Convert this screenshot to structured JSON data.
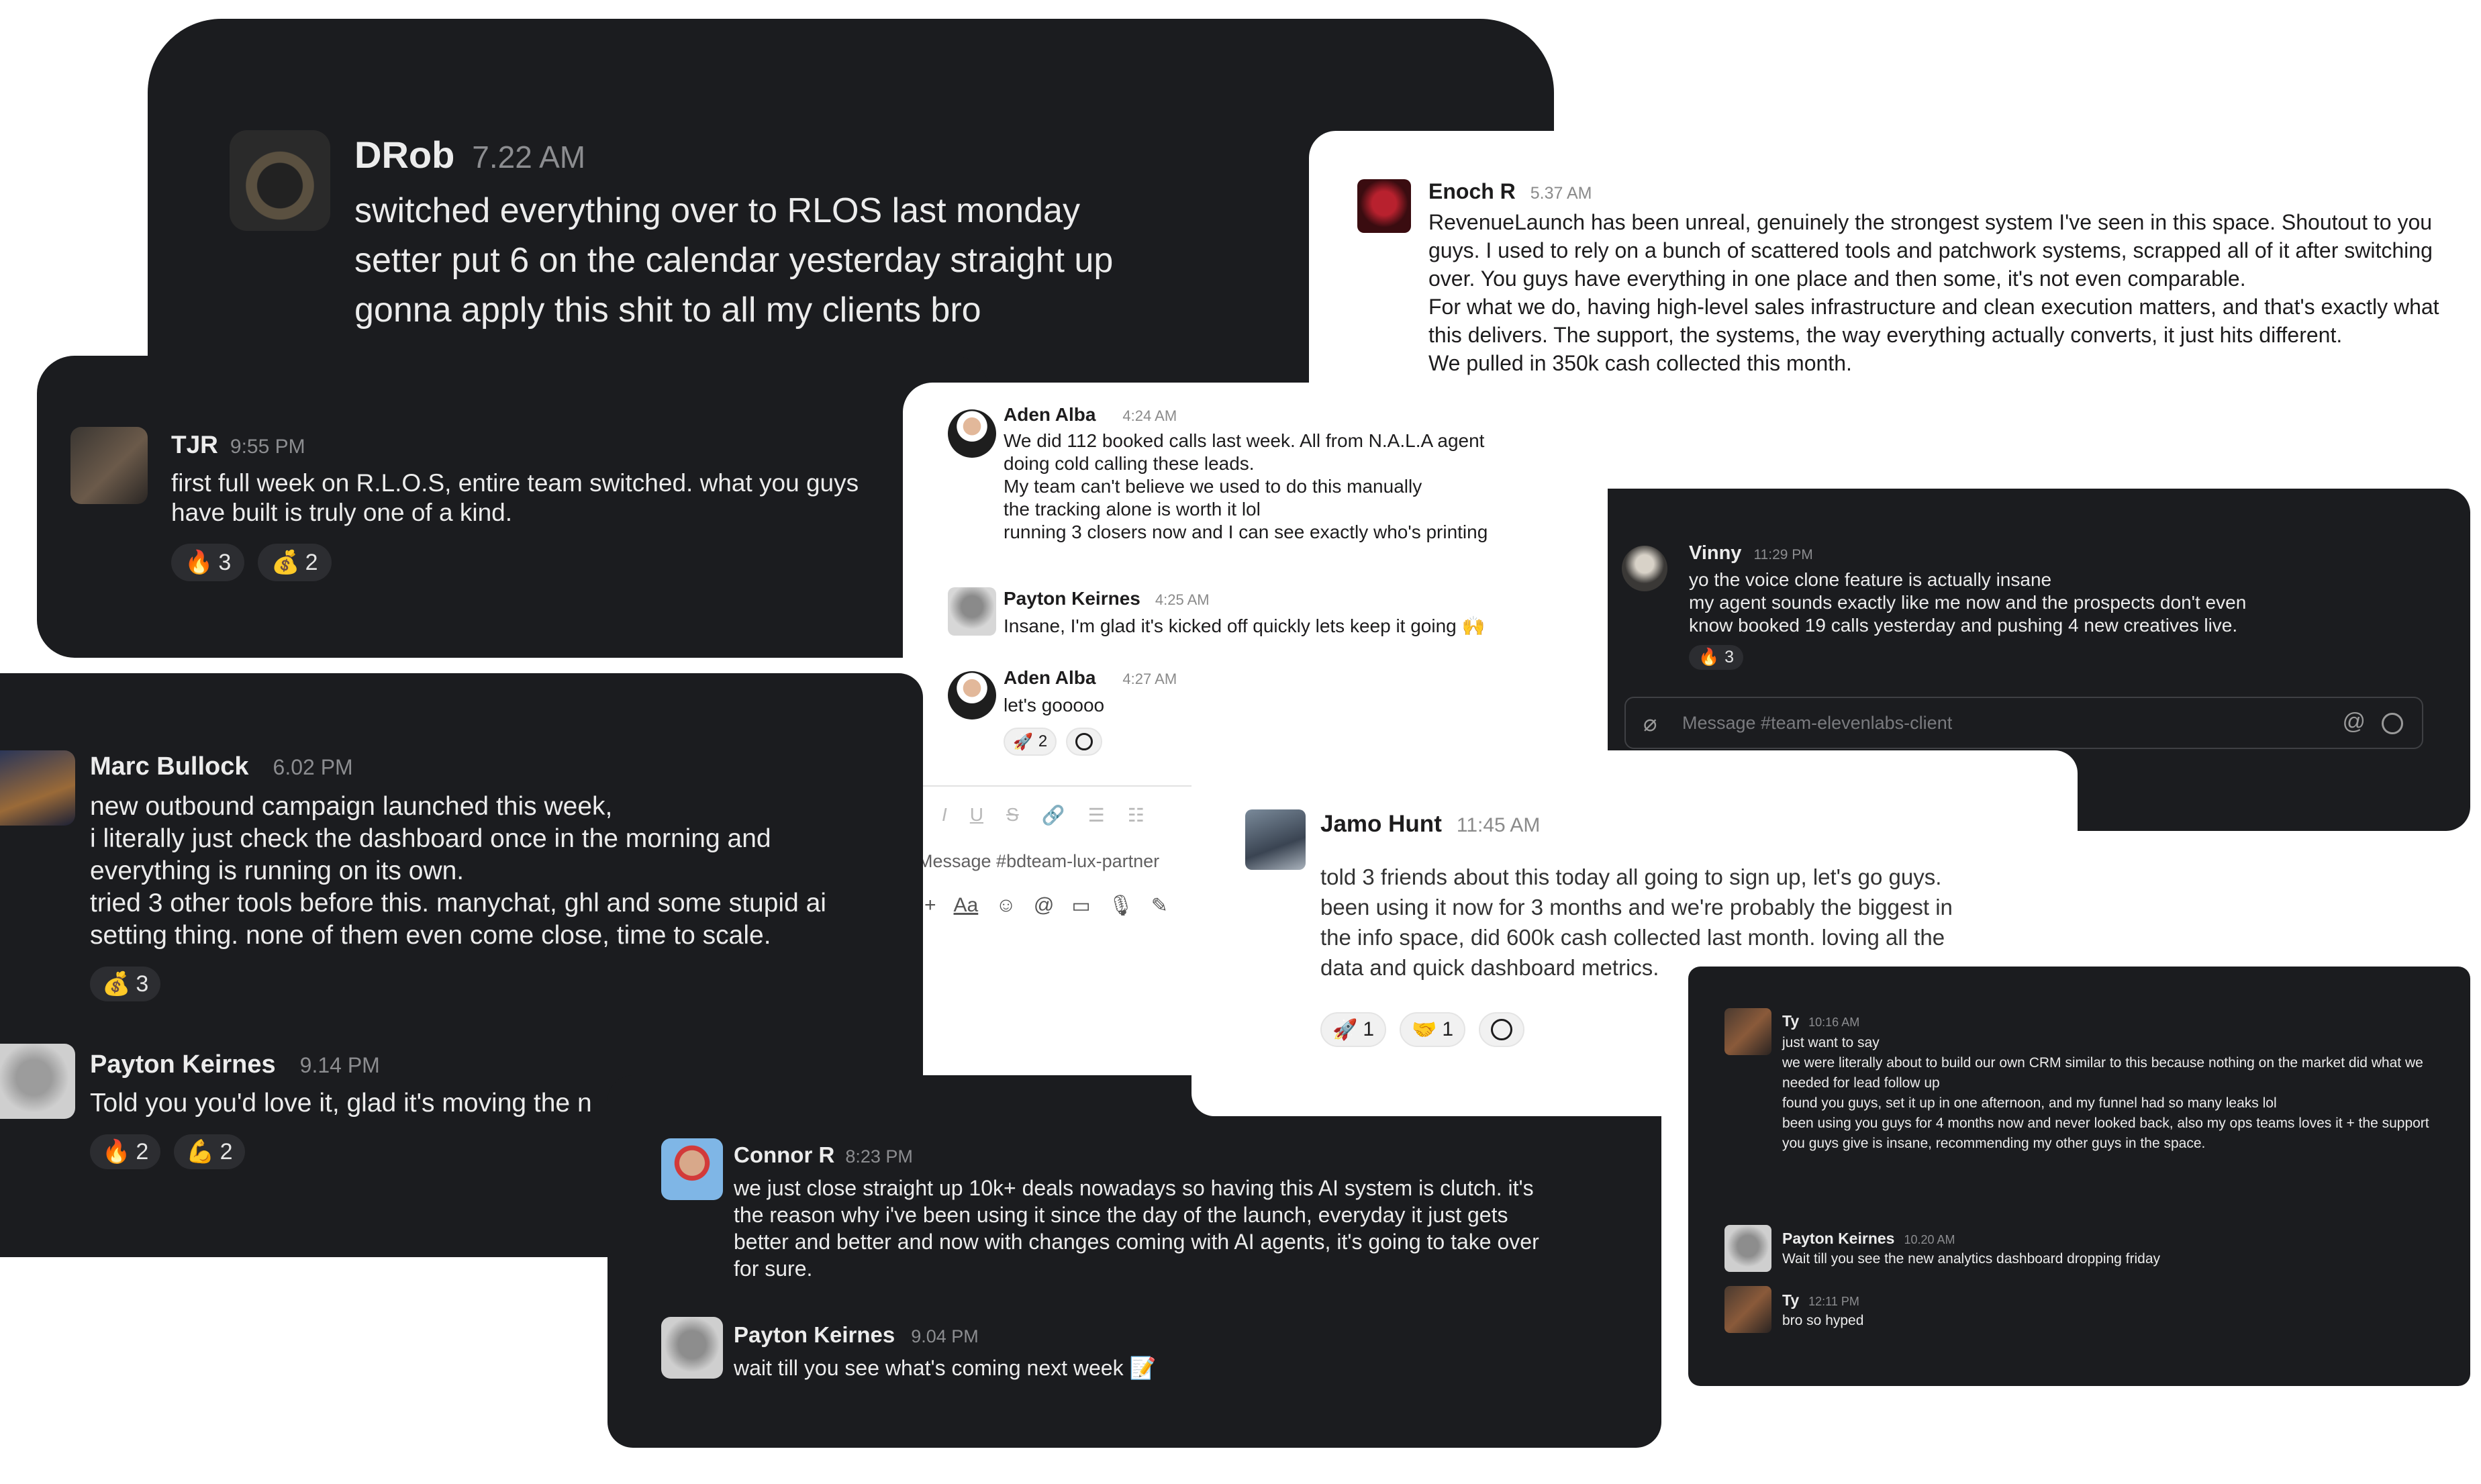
{
  "cards": {
    "drob": {
      "name": "DRob",
      "time": "7.22 AM",
      "text": "switched everything over to RLOS last monday\nsetter put 6 on the calendar yesterday straight up\ngonna apply this shit to all my clients bro"
    },
    "enoch": {
      "name": "Enoch R",
      "time": "5.37 AM",
      "text": "RevenueLaunch has been unreal, genuinely the strongest system I've seen in this space. Shoutout to you guys. I used to rely on a bunch of scattered tools and patchwork systems, scrapped all of it after switching over. You guys have everything in one place and then some, it's not even comparable.\nFor what we do, having high-level sales infrastructure and clean execution matters, and that's exactly what this delivers. The support, the systems, the way everything actually converts, it just hits different.\nWe pulled in 350k cash collected this month."
    },
    "tjr": {
      "name": "TJR",
      "time": "9:55 PM",
      "text": "first full week on R.L.O.S, entire team switched. what you guys have built is truly one of a kind.",
      "reactions": [
        {
          "emoji": "🔥",
          "count": "3"
        },
        {
          "emoji": "💰",
          "count": "2"
        }
      ]
    },
    "aden": {
      "messages": [
        {
          "name": "Aden Alba",
          "time": "4:24 AM",
          "text": "We did 112 booked calls last week. All from N.A.L.A agent\ndoing cold calling these leads.\nMy team can't believe we used to do this manually\nthe tracking alone is worth it lol\nrunning 3 closers now and I can see exactly who's printing"
        },
        {
          "name": "Payton Keirnes",
          "time": "4:25 AM",
          "text": "Insane, I'm glad it's kicked off quickly lets keep it going 🙌"
        },
        {
          "name": "Aden Alba",
          "time": "4:27 AM",
          "text": "let's gooooo"
        }
      ],
      "reaction": {
        "emoji": "🚀",
        "count": "2"
      },
      "toolbar": [
        "I",
        "U",
        "S",
        "🔗",
        "☰",
        "☷"
      ],
      "composer_placeholder": "Message #bdteam-lux-partner",
      "composer_tools": [
        "+",
        "Aa",
        "☺",
        "@",
        "▭",
        "🎙",
        "✎"
      ]
    },
    "vinny": {
      "name": "Vinny",
      "time": "11:29 PM",
      "text": "yo the voice clone feature is actually insane\nmy agent sounds exactly like me now and the prospects don't even\nknow booked 19 calls yesterday and pushing 4 new creatives live.",
      "reaction": {
        "emoji": "🔥",
        "count": "3"
      },
      "composer_placeholder": "Message #team-elevenlabs-client"
    },
    "marc": {
      "messages": [
        {
          "name": "Marc Bullock",
          "time": "6.02 PM",
          "text": "new outbound campaign launched this week,\ni literally just check the dashboard once in the morning and\neverything is running on its own.\ntried 3 other tools before this. manychat, ghl and some stupid ai\nsetting thing. none of them even come close, time to scale."
        },
        {
          "name": "Payton Keirnes",
          "time": "9.14 PM",
          "text": "Told you you'd love it, glad it's moving the n"
        }
      ],
      "reactions_1": [
        {
          "emoji": "💰",
          "count": "3"
        }
      ],
      "reactions_2": [
        {
          "emoji": "🔥",
          "count": "2"
        },
        {
          "emoji": "💪",
          "count": "2"
        }
      ]
    },
    "jamo": {
      "name": "Jamo Hunt",
      "time": "11:45 AM",
      "text": "told 3 friends about this today all going to sign up, let's go guys.\nbeen using it now for 3 months and we're probably the biggest in\nthe info space, did 600k cash collected last month. loving all the\ndata and quick dashboard metrics.",
      "reactions": [
        {
          "emoji": "🚀",
          "count": "1"
        },
        {
          "emoji": "🤝",
          "count": "1"
        }
      ]
    },
    "connor": {
      "messages": [
        {
          "name": "Connor R",
          "time": "8:23 PM",
          "text": "we just close straight up 10k+ deals nowadays so having this AI system is clutch. it's the reason why i've been using it since the day of the launch, everyday it just gets better and better and now with changes coming with AI agents, it's going to take over for sure."
        },
        {
          "name": "Payton Keirnes",
          "time": "9.04 PM",
          "text": "wait till you see what's coming next week 📝"
        }
      ]
    },
    "ty": {
      "messages": [
        {
          "name": "Ty",
          "time": "10:16 AM",
          "text": "just want to say\nwe were literally about to build our own CRM similar to this because nothing on the market did what we needed for lead follow up\nfound you guys, set it up in one afternoon, and my funnel had so many leaks lol\nbeen using you guys for 4 months now and never looked back, also my ops teams loves it + the support you guys give is insane, recommending my other guys in the space."
        },
        {
          "name": "Payton Keirnes",
          "time": "10.20 AM",
          "text": "Wait till you see the new analytics dashboard dropping friday"
        },
        {
          "name": "Ty",
          "time": "12:11 PM",
          "text": "bro so hyped"
        }
      ]
    }
  },
  "colors": {
    "dark_card": "#1b1c1f",
    "light_card": "#ffffff",
    "muted_text": "#8c8d90"
  }
}
